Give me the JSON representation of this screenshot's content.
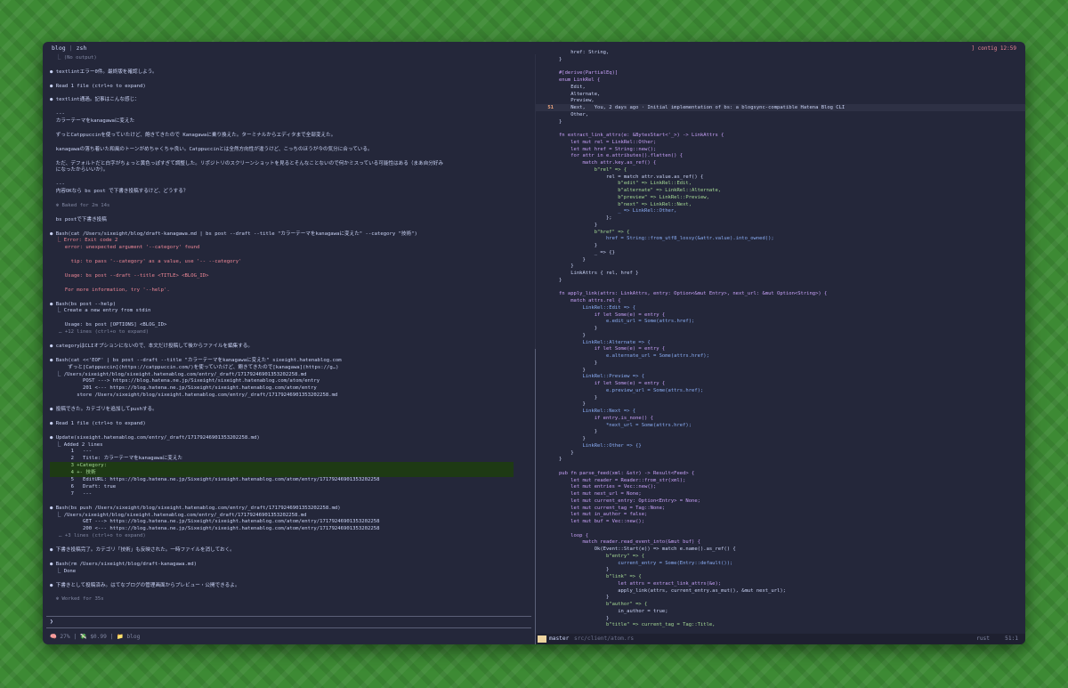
{
  "window": {
    "tab_left_1": "blog",
    "tab_left_2": "zsh",
    "tab_right": "] contig 12:59"
  },
  "left_lines": [
    {
      "t": "  ⎿ (No output)",
      "c": "dim"
    },
    {
      "t": "",
      "c": ""
    },
    {
      "t": "● textlintエラー0件。最終版を確認しよう。",
      "c": "wht"
    },
    {
      "t": "",
      "c": ""
    },
    {
      "t": "● Read 1 file (ctrl+o to expand)",
      "c": "wht"
    },
    {
      "t": "",
      "c": ""
    },
    {
      "t": "● textlint通過。記事はこんな感じ：",
      "c": "wht"
    },
    {
      "t": "",
      "c": ""
    },
    {
      "t": "  ---",
      "c": "wht"
    },
    {
      "t": "  カラーテーマをkanagawaに変えた",
      "c": "wht"
    },
    {
      "t": "",
      "c": ""
    },
    {
      "t": "  ずっとCatppuccinを使っていたけど、飽きてきたので Kanagawaに乗り換えた。ターミナルからエディタまで全部変えた。",
      "c": "wht"
    },
    {
      "t": "",
      "c": ""
    },
    {
      "t": "  kanagawaの落ち着いた和風のトーンがめちゃくちゃ良い。Catppuccinとは全然方向性が違うけど、こっちのほうが今の気分に合っている。",
      "c": "wht"
    },
    {
      "t": "",
      "c": ""
    },
    {
      "t": "  ただ、デフォルトだと白字がちょっと黄色っぽすぎて調整した。リポジトリのスクリーンショットを見るとそんなことないので何かミスっている可能性はある（まあ自分好み",
      "c": "wht"
    },
    {
      "t": "  になったからいいか）。",
      "c": "wht"
    },
    {
      "t": "",
      "c": ""
    },
    {
      "t": "  ---",
      "c": "wht"
    },
    {
      "t": "  内容OKなら bs post で下書き投稿するけど、どうする？",
      "c": "wht"
    },
    {
      "t": "",
      "c": ""
    },
    {
      "t": "  ✻ Baked for 2m 14s",
      "c": "dim"
    },
    {
      "t": "",
      "c": ""
    },
    {
      "t": "  bs postで下書き投稿",
      "c": "wht"
    },
    {
      "t": "",
      "c": ""
    },
    {
      "t": "● Bash(cat /Users/sixeight/blog/draft-kanagawa.md | bs post --draft --title \"カラーテーマをkanagawaに変えた\" --category \"技術\")",
      "c": "wht"
    },
    {
      "t": "  ⎿ Error: Exit code 2",
      "c": "red"
    },
    {
      "t": "     error: unexpected argument '--category' found",
      "c": "red"
    },
    {
      "t": "",
      "c": ""
    },
    {
      "t": "       tip: to pass '--category' as a value, use '-- --category'",
      "c": "red"
    },
    {
      "t": "",
      "c": ""
    },
    {
      "t": "     Usage: bs post --draft --title <TITLE> <BLOG_ID>",
      "c": "red"
    },
    {
      "t": "",
      "c": ""
    },
    {
      "t": "     For more information, try '--help'.",
      "c": "red"
    },
    {
      "t": "",
      "c": ""
    },
    {
      "t": "● Bash(bs post --help)",
      "c": "wht"
    },
    {
      "t": "  ⎿ Create a new entry from stdin",
      "c": "wht"
    },
    {
      "t": "",
      "c": ""
    },
    {
      "t": "     Usage: bs post [OPTIONS] <BLOG_ID>",
      "c": "wht"
    },
    {
      "t": "   … +12 lines (ctrl+o to expand)",
      "c": "dim"
    },
    {
      "t": "",
      "c": ""
    },
    {
      "t": "● categoryはCLIオプションにないので、本文だけ投稿して後からファイルを編集する。",
      "c": "wht"
    },
    {
      "t": "",
      "c": ""
    },
    {
      "t": "● Bash(cat <<'EOF' | bs post --draft --title \"カラーテーマをkanagawaに変えた\" sixeight.hatenablog.com",
      "c": "wht"
    },
    {
      "t": "      ずっと[Catppuccin](https://catppuccin.com/)を使っていたけど、飽きてきたので[kanagawa](https://g…)",
      "c": "wht"
    },
    {
      "t": "  ⎿ /Users/sixeight/blog/sixeight.hatenablog.com/entry/_draft/17179246901353202258.md",
      "c": "wht"
    },
    {
      "t": "           POST ---> https://blog.hatena.ne.jp/Sixeight/sixeight.hatenablog.com/atom/entry",
      "c": "wht"
    },
    {
      "t": "           201 <--- https://blog.hatena.ne.jp/Sixeight/sixeight.hatenablog.com/atom/entry",
      "c": "wht"
    },
    {
      "t": "         store /Users/sixeight/blog/sixeight.hatenablog.com/entry/_draft/17179246901353202258.md",
      "c": "wht"
    },
    {
      "t": "",
      "c": ""
    },
    {
      "t": "● 投稿できた。カテゴリを追加してpushする。",
      "c": "wht"
    },
    {
      "t": "",
      "c": ""
    },
    {
      "t": "● Read 1 file (ctrl+o to expand)",
      "c": "wht"
    },
    {
      "t": "",
      "c": ""
    },
    {
      "t": "● Update(sixeight.hatenablog.com/entry/_draft/17179246901353202258.md)",
      "c": "wht"
    },
    {
      "t": "  ⎿ Added 2 lines",
      "c": "wht"
    },
    {
      "t": "       1   ---",
      "c": "wht"
    },
    {
      "t": "       2   Title: カラーテーマをkanagawaに変えた",
      "c": "wht"
    },
    {
      "t": "       3 +Category:",
      "c": "add"
    },
    {
      "t": "       4 +- 技術",
      "c": "add"
    },
    {
      "t": "       5   EditURL: https://blog.hatena.ne.jp/Sixeight/sixeight.hatenablog.com/atom/entry/17179246901353202258",
      "c": "wht"
    },
    {
      "t": "       6   Draft: true",
      "c": "wht"
    },
    {
      "t": "       7   ---",
      "c": "wht"
    },
    {
      "t": "",
      "c": ""
    },
    {
      "t": "● Bash(bs push /Users/sixeight/blog/sixeight.hatenablog.com/entry/_draft/17179246901353202258.md)",
      "c": "wht"
    },
    {
      "t": "  ⎿ /Users/sixeight/blog/sixeight.hatenablog.com/entry/_draft/17179246901353202258.md",
      "c": "wht"
    },
    {
      "t": "           GET ---> https://blog.hatena.ne.jp/Sixeight/sixeight.hatenablog.com/atom/entry/17179246901353202258",
      "c": "wht"
    },
    {
      "t": "           200 <--- https://blog.hatena.ne.jp/Sixeight/sixeight.hatenablog.com/atom/entry/17179246901353202258",
      "c": "wht"
    },
    {
      "t": "   … +3 lines (ctrl+o to expand)",
      "c": "dim"
    },
    {
      "t": "",
      "c": ""
    },
    {
      "t": "● 下書き投稿完了。カテゴリ「技術」も反映された。一時ファイルを消しておく。",
      "c": "wht"
    },
    {
      "t": "",
      "c": ""
    },
    {
      "t": "● Bash(rm /Users/sixeight/blog/draft-kanagawa.md)",
      "c": "wht"
    },
    {
      "t": "  ⎿ Done",
      "c": "wht"
    },
    {
      "t": "",
      "c": ""
    },
    {
      "t": "● 下書きとして投稿済み。はてなブログの管理画面からプレビュー・公開できるよ。",
      "c": "wht"
    },
    {
      "t": "",
      "c": ""
    },
    {
      "t": "  ✻ Worked for 35s",
      "c": "dim"
    }
  ],
  "prompt": {
    "symbol": "❯"
  },
  "footer": "🧠 27% | 💸 $0.99 | 📁 blog",
  "code_lines": [
    {
      "n": "",
      "t": "    href: String,"
    },
    {
      "n": "",
      "t": "}"
    },
    {
      "n": "",
      "t": ""
    },
    {
      "n": "",
      "t": "#[derive(PartialEq)]"
    },
    {
      "n": "",
      "t": "enum LinkRel {"
    },
    {
      "n": "",
      "t": "    Edit,"
    },
    {
      "n": "",
      "t": "    Alternate,"
    },
    {
      "n": "",
      "t": "    Preview,"
    },
    {
      "n": "51",
      "t": "    Next,   You, 2 days ago · Initial implementation of bs: a blogsync-compatible Hatena Blog CLI",
      "cur": true
    },
    {
      "n": "",
      "t": "    Other,"
    },
    {
      "n": "",
      "t": "}"
    },
    {
      "n": "",
      "t": ""
    },
    {
      "n": "",
      "t": "fn extract_link_attrs(e: &BytesStart<'_>) -> LinkAttrs {"
    },
    {
      "n": "",
      "t": "    let mut rel = LinkRel::Other;"
    },
    {
      "n": "",
      "t": "    let mut href = String::new();"
    },
    {
      "n": "",
      "t": "    for attr in e.attributes().flatten() {"
    },
    {
      "n": "",
      "t": "        match attr.key.as_ref() {"
    },
    {
      "n": "",
      "t": "            b\"rel\" => {"
    },
    {
      "n": "",
      "t": "                rel = match attr.value.as_ref() {"
    },
    {
      "n": "",
      "t": "                    b\"edit\" => LinkRel::Edit,"
    },
    {
      "n": "",
      "t": "                    b\"alternate\" => LinkRel::Alternate,"
    },
    {
      "n": "",
      "t": "                    b\"preview\" => LinkRel::Preview,"
    },
    {
      "n": "",
      "t": "                    b\"next\" => LinkRel::Next,"
    },
    {
      "n": "",
      "t": "                    _ => LinkRel::Other,"
    },
    {
      "n": "",
      "t": "                };"
    },
    {
      "n": "",
      "t": "            }"
    },
    {
      "n": "",
      "t": "            b\"href\" => {"
    },
    {
      "n": "",
      "t": "                href = String::from_utf8_lossy(&attr.value).into_owned();"
    },
    {
      "n": "",
      "t": "            }"
    },
    {
      "n": "",
      "t": "            _ => {}"
    },
    {
      "n": "",
      "t": "        }"
    },
    {
      "n": "",
      "t": "    }"
    },
    {
      "n": "",
      "t": "    LinkAttrs { rel, href }"
    },
    {
      "n": "",
      "t": "}"
    },
    {
      "n": "",
      "t": ""
    },
    {
      "n": "",
      "t": "fn apply_link(attrs: LinkAttrs, entry: Option<&mut Entry>, next_url: &mut Option<String>) {"
    },
    {
      "n": "",
      "t": "    match attrs.rel {"
    },
    {
      "n": "",
      "t": "        LinkRel::Edit => {"
    },
    {
      "n": "",
      "t": "            if let Some(e) = entry {"
    },
    {
      "n": "",
      "t": "                e.edit_url = Some(attrs.href);"
    },
    {
      "n": "",
      "t": "            }"
    },
    {
      "n": "",
      "t": "        }"
    },
    {
      "n": "",
      "t": "        LinkRel::Alternate => {"
    },
    {
      "n": "",
      "t": "            if let Some(e) = entry {"
    },
    {
      "n": "",
      "t": "                e.alternate_url = Some(attrs.href);"
    },
    {
      "n": "",
      "t": "            }"
    },
    {
      "n": "",
      "t": "        }"
    },
    {
      "n": "",
      "t": "        LinkRel::Preview => {"
    },
    {
      "n": "",
      "t": "            if let Some(e) = entry {"
    },
    {
      "n": "",
      "t": "                e.preview_url = Some(attrs.href);"
    },
    {
      "n": "",
      "t": "            }"
    },
    {
      "n": "",
      "t": "        }"
    },
    {
      "n": "",
      "t": "        LinkRel::Next => {"
    },
    {
      "n": "",
      "t": "            if entry.is_none() {"
    },
    {
      "n": "",
      "t": "                *next_url = Some(attrs.href);"
    },
    {
      "n": "",
      "t": "            }"
    },
    {
      "n": "",
      "t": "        }"
    },
    {
      "n": "",
      "t": "        LinkRel::Other => {}"
    },
    {
      "n": "",
      "t": "    }"
    },
    {
      "n": "",
      "t": "}"
    },
    {
      "n": "",
      "t": ""
    },
    {
      "n": "",
      "t": "pub fn parse_feed(xml: &str) -> Result<Feed> {"
    },
    {
      "n": "",
      "t": "    let mut reader = Reader::from_str(xml);"
    },
    {
      "n": "",
      "t": "    let mut entries = Vec::new();"
    },
    {
      "n": "",
      "t": "    let mut next_url = None;"
    },
    {
      "n": "",
      "t": "    let mut current_entry: Option<Entry> = None;"
    },
    {
      "n": "",
      "t": "    let mut current_tag = Tag::None;"
    },
    {
      "n": "",
      "t": "    let mut in_author = false;"
    },
    {
      "n": "",
      "t": "    let mut buf = Vec::new();"
    },
    {
      "n": "",
      "t": ""
    },
    {
      "n": "",
      "t": "    loop {"
    },
    {
      "n": "",
      "t": "        match reader.read_event_into(&mut buf) {"
    },
    {
      "n": "",
      "t": "            Ok(Event::Start(e)) => match e.name().as_ref() {"
    },
    {
      "n": "",
      "t": "                b\"entry\" => {"
    },
    {
      "n": "",
      "t": "                    current_entry = Some(Entry::default());"
    },
    {
      "n": "",
      "t": "                }"
    },
    {
      "n": "",
      "t": "                b\"link\" => {"
    },
    {
      "n": "",
      "t": "                    let attrs = extract_link_attrs(&e);"
    },
    {
      "n": "",
      "t": "                    apply_link(attrs, current_entry.as_mut(), &mut next_url);"
    },
    {
      "n": "",
      "t": "                }"
    },
    {
      "n": "",
      "t": "                b\"author\" => {"
    },
    {
      "n": "",
      "t": "                    in_author = true;"
    },
    {
      "n": "",
      "t": "                }"
    },
    {
      "n": "",
      "t": "                b\"title\" => current_tag = Tag::Title,"
    }
  ],
  "statusbar": {
    "branch": "master",
    "path": "src/client/atom.rs",
    "lang": "rust",
    "pos": "51:1"
  }
}
